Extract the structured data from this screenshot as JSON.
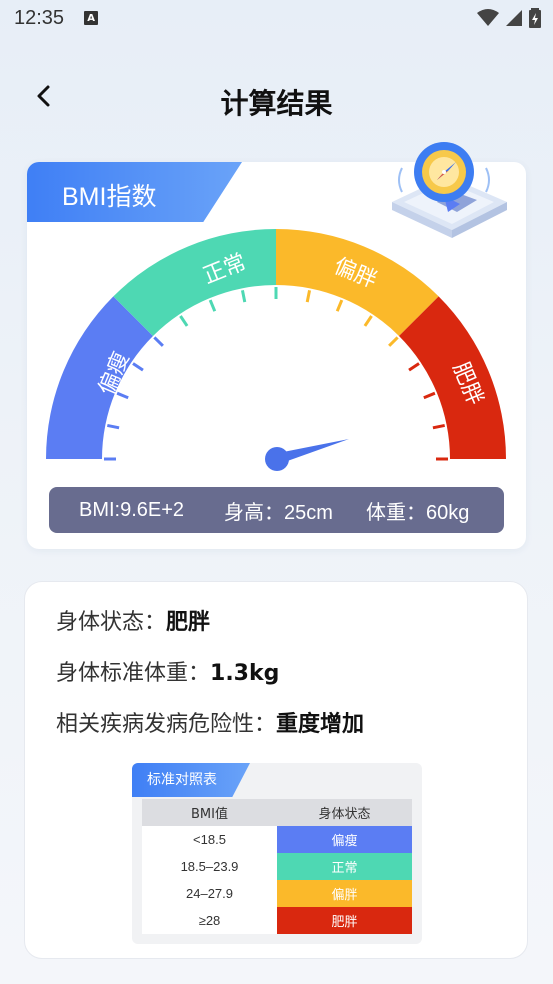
{
  "status_bar": {
    "time": "12:35",
    "notification_icon": "A"
  },
  "header": {
    "title": "计算结果",
    "back_icon": "chevron-left-icon"
  },
  "bmi_card": {
    "tab_label": "BMI指数",
    "gauge_segments": [
      {
        "label": "偏瘦",
        "color": "#5b7df3"
      },
      {
        "label": "正常",
        "color": "#4ed8b3"
      },
      {
        "label": "偏胖",
        "color": "#fbb92a"
      },
      {
        "label": "肥胖",
        "color": "#d9280f"
      }
    ],
    "info": {
      "bmi": "BMI:9.6E+2",
      "height": "身高：25cm",
      "weight": "体重：60kg"
    }
  },
  "result": {
    "status_label": "身体状态：",
    "status_value": "肥胖",
    "standard_weight_label": "身体标准体重：",
    "standard_weight_value": "1.3kg",
    "risk_label": "相关疾病发病危险性：",
    "risk_value": "重度增加"
  },
  "reference_table": {
    "tab_label": "标准对照表",
    "headers": [
      "BMI值",
      "身体状态"
    ],
    "rows": [
      {
        "range": "<18.5",
        "status": "偏瘦",
        "color": "#5b7df3"
      },
      {
        "range": "18.5–23.9",
        "status": "正常",
        "color": "#4ed8b3"
      },
      {
        "range": "24–27.9",
        "status": "偏胖",
        "color": "#fbb92a"
      },
      {
        "range": "≥28",
        "status": "肥胖",
        "color": "#d9280f"
      }
    ]
  }
}
